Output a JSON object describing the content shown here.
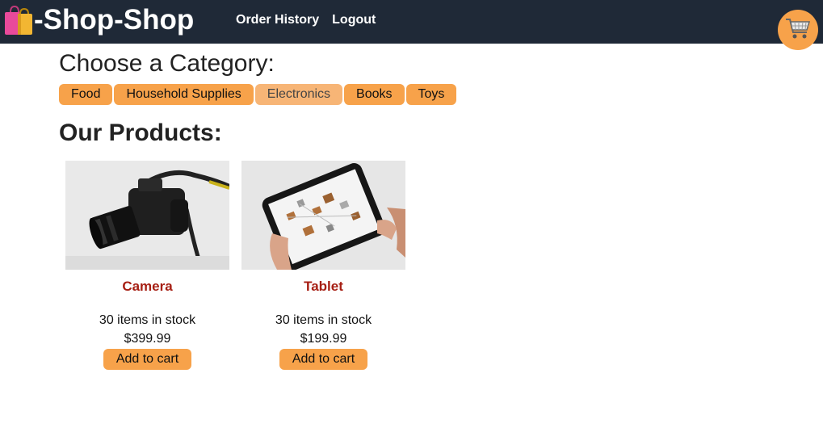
{
  "header": {
    "brand_emoji": "shopping-bags-icon",
    "brand_text": "-Shop-Shop",
    "nav": [
      {
        "label": "Order History"
      },
      {
        "label": "Logout"
      }
    ],
    "cart_icon": "shopping-cart-icon"
  },
  "categories": {
    "heading": "Choose a Category:",
    "items": [
      {
        "label": "Food",
        "active": false
      },
      {
        "label": "Household Supplies",
        "active": false
      },
      {
        "label": "Electronics",
        "active": true
      },
      {
        "label": "Books",
        "active": false
      },
      {
        "label": "Toys",
        "active": false
      }
    ]
  },
  "products": {
    "heading": "Our Products:",
    "items": [
      {
        "name": "Camera",
        "stock": "30 items in stock",
        "price": "$399.99",
        "button": "Add to cart",
        "image": "camera-photo"
      },
      {
        "name": "Tablet",
        "stock": "30 items in stock",
        "price": "$199.99",
        "button": "Add to cart",
        "image": "tablet-photo"
      }
    ]
  },
  "colors": {
    "header_bg": "#1f2937",
    "accent": "#f7a24a",
    "product_name": "#a61e13"
  }
}
